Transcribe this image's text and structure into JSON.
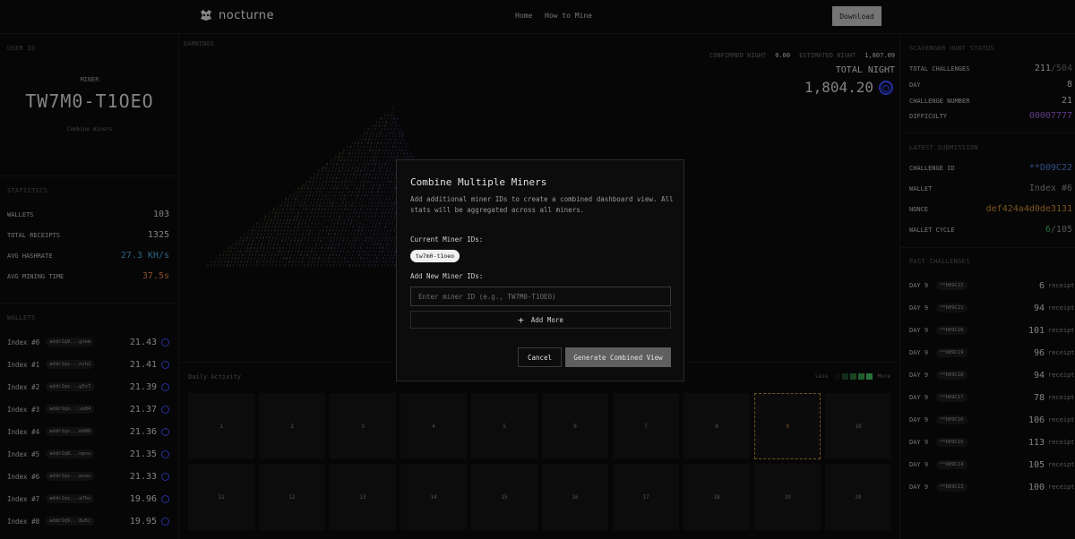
{
  "app": {
    "name": "nocturne",
    "nav": [
      "Home",
      "How to Mine"
    ],
    "download_label": "Download"
  },
  "user": {
    "section_label": "USER ID",
    "miner_caption": "MINER",
    "miner_id": "TW7M0-T1OEO",
    "combine_link": "Combine miners"
  },
  "statistics": {
    "label": "STATISTICS",
    "rows": [
      {
        "key": "WALLETS",
        "value": "103",
        "color": "#d0d0d0"
      },
      {
        "key": "TOTAL RECEIPTS",
        "value": "1325",
        "color": "#d0d0d0"
      },
      {
        "key": "AVG HASHRATE",
        "value": "27.3 KH/s",
        "color": "#4f9fd6"
      },
      {
        "key": "AVG MINING TIME",
        "value": "37.5s",
        "color": "#e07a4a"
      }
    ]
  },
  "wallets": {
    "label": "WALLETS",
    "items": [
      {
        "index": "Index #0",
        "addr": "addr1q9...gskm",
        "value": "21.43"
      },
      {
        "index": "Index #1",
        "addr": "addr1qx...nch2",
        "value": "21.41"
      },
      {
        "index": "Index #2",
        "addr": "addr1qx...g5v7",
        "value": "21.39"
      },
      {
        "index": "Index #3",
        "addr": "addr1qx...vp84",
        "value": "21.37"
      },
      {
        "index": "Index #4",
        "addr": "addr1qx...m988",
        "value": "21.36"
      },
      {
        "index": "Index #5",
        "addr": "addr1q8...npvu",
        "value": "21.35"
      },
      {
        "index": "Index #6",
        "addr": "addr1qx...pvws",
        "value": "21.33"
      },
      {
        "index": "Index #7",
        "addr": "addr1qx...a7hz",
        "value": "19.96"
      },
      {
        "index": "Index #8",
        "addr": "addr1q9...8u5c",
        "value": "19.95"
      }
    ]
  },
  "earnings": {
    "label": "EARNINGS",
    "confirmed_label": "CONFIRMED NIGHT",
    "confirmed_value": "0.00",
    "estimated_label": "ESTIMATED NIGHT",
    "estimated_value": "1,807.09",
    "total_label": "TOTAL NIGHT",
    "total_value": "1,804.20"
  },
  "daily": {
    "label": "Daily Activity",
    "legend_less": "Less",
    "legend_more": "More",
    "legend_colors": [
      "#141414",
      "#1f4a2a",
      "#2a6e38",
      "#35924a",
      "#41b85b"
    ],
    "days": [
      "1",
      "2",
      "3",
      "4",
      "5",
      "6",
      "7",
      "8",
      "9",
      "10",
      "11",
      "12",
      "13",
      "14",
      "15",
      "16",
      "17",
      "18",
      "19",
      "20"
    ],
    "active_day": "9"
  },
  "scavenger": {
    "label": "SCAVENGER HUNT STATUS",
    "total_label": "TOTAL CHALLENGES",
    "total_done": "211",
    "total_all": "/504",
    "day_label": "DAY",
    "day_value": "8",
    "number_label": "CHALLENGE NUMBER",
    "number_value": "21",
    "difficulty_label": "DIFFICULTY",
    "difficulty_value": "00007777",
    "difficulty_color": "#9a5cd6"
  },
  "latest": {
    "label": "LATEST SUBMISSION",
    "challenge_label": "CHALLENGE ID",
    "challenge_value": "**D09C22",
    "challenge_color": "#4f7fd6",
    "wallet_label": "WALLET",
    "wallet_value": "Index #6",
    "nonce_label": "NONCE",
    "nonce_value": "def424a4d0de3131",
    "nonce_color": "#c98a2f",
    "cycle_label": "WALLET CYCLE",
    "cycle_done": "6",
    "cycle_all": "/105",
    "cycle_color": "#3fb05a"
  },
  "past": {
    "label": "PAST CHALLENGES",
    "unit": "receipts",
    "items": [
      {
        "day": "DAY 9",
        "id": "**D09C22",
        "count": "6"
      },
      {
        "day": "DAY 9",
        "id": "**D09C21",
        "count": "94"
      },
      {
        "day": "DAY 9",
        "id": "**D09C20",
        "count": "101"
      },
      {
        "day": "DAY 9",
        "id": "**D09C19",
        "count": "96"
      },
      {
        "day": "DAY 9",
        "id": "**D09C18",
        "count": "94"
      },
      {
        "day": "DAY 9",
        "id": "**D09C17",
        "count": "78"
      },
      {
        "day": "DAY 9",
        "id": "**D09C16",
        "count": "106"
      },
      {
        "day": "DAY 9",
        "id": "**D09C15",
        "count": "113"
      },
      {
        "day": "DAY 9",
        "id": "**D09C14",
        "count": "105"
      },
      {
        "day": "DAY 9",
        "id": "**D09C13",
        "count": "100"
      }
    ]
  },
  "modal": {
    "title": "Combine Multiple Miners",
    "description": "Add additional miner IDs to create a combined dashboard view. All stats will be aggregated across all miners.",
    "current_label": "Current Miner IDs:",
    "current_ids": [
      "tw7m0-t1oeo"
    ],
    "add_label": "Add New Miner IDs:",
    "input_placeholder": "Enter miner ID (e.g., TW7M0-T1OEO)",
    "input_value": "",
    "add_more_label": "Add More",
    "cancel_label": "Cancel",
    "generate_label": "Generate Combined View"
  }
}
